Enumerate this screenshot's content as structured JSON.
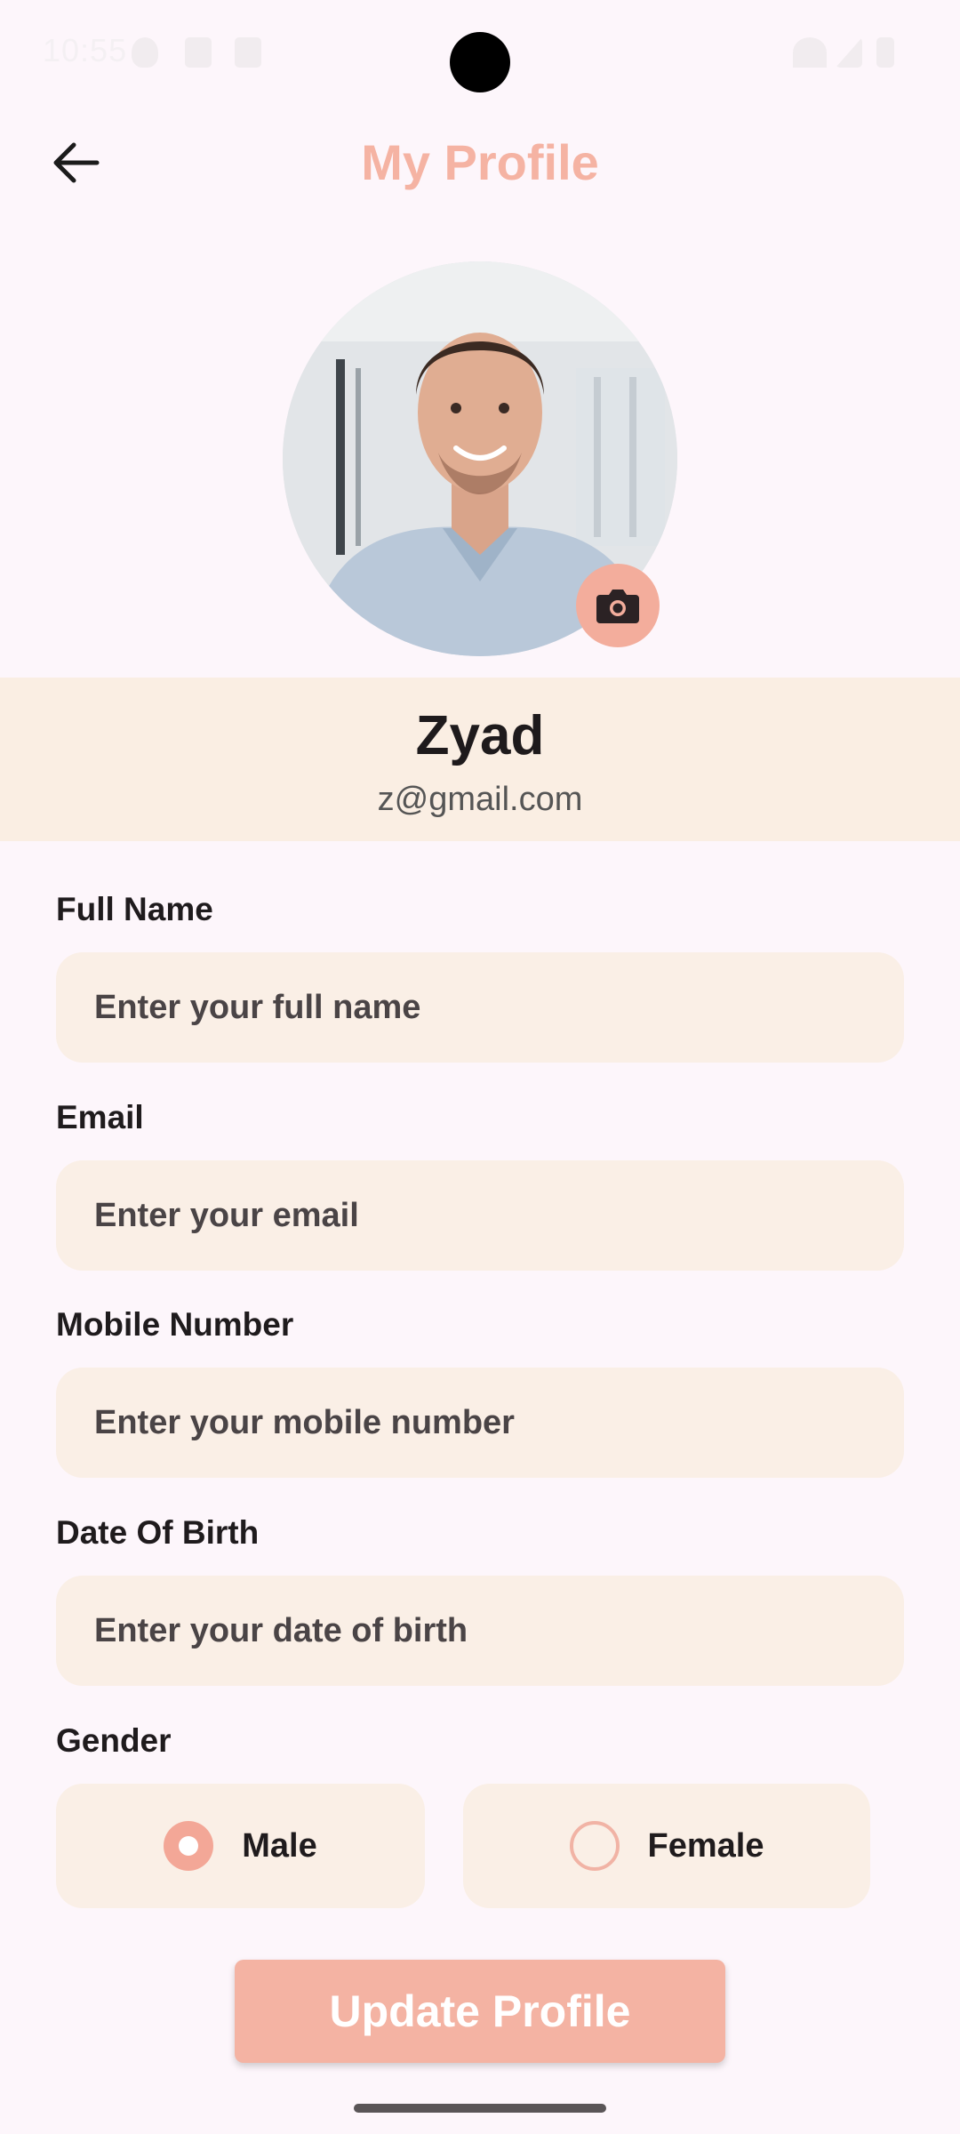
{
  "status_bar": {
    "time": "10:55"
  },
  "header": {
    "title": "My Profile",
    "back_icon": "arrow-left-icon"
  },
  "profile": {
    "name": "Zyad",
    "email": "z@gmail.com",
    "camera_icon": "camera-icon"
  },
  "form": {
    "full_name": {
      "label": "Full Name",
      "placeholder": "Enter your full name",
      "value": ""
    },
    "email": {
      "label": "Email",
      "placeholder": "Enter your email",
      "value": ""
    },
    "mobile": {
      "label": "Mobile Number",
      "placeholder": "Enter your mobile number",
      "value": ""
    },
    "dob": {
      "label": "Date Of Birth",
      "placeholder": "Enter your date of birth",
      "value": ""
    },
    "gender": {
      "label": "Gender",
      "options": [
        {
          "label": "Male",
          "selected": true
        },
        {
          "label": "Female",
          "selected": false
        }
      ]
    }
  },
  "actions": {
    "update_label": "Update Profile"
  },
  "colors": {
    "accent": "#f4b3a3",
    "field_background": "#faefe6",
    "page_background": "#fdf6fb",
    "name_band_background": "#faeee3"
  }
}
